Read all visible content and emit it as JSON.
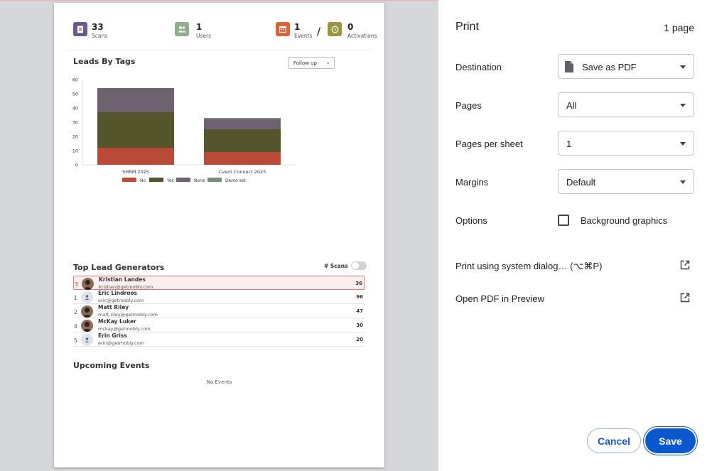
{
  "preview": {
    "stats": {
      "scans": {
        "count": "33",
        "label": "Scans",
        "color": "#6a5a8a",
        "icon": "badge-icon"
      },
      "users": {
        "count": "1",
        "label": "Users",
        "color": "#8fb08a",
        "icon": "users-icon"
      },
      "events": {
        "count": "1",
        "label": "Events",
        "color": "#d9623b",
        "icon": "calendar-icon"
      },
      "activations": {
        "count": "0",
        "label": "Activations",
        "color": "#9a963f",
        "icon": "clock-icon"
      },
      "separator": "/"
    },
    "leads_by_tags": {
      "title": "Leads By Tags",
      "filter_value": "Follow up"
    },
    "top_lead_generators": {
      "title": "Top Lead Generators",
      "toggle_label": "# Scans",
      "rows": [
        {
          "rank": "3",
          "name": "Kristian Landes",
          "email": "kristian@getmobly.com",
          "scans": "36",
          "avatar": "photo"
        },
        {
          "rank": "1",
          "name": "Eric Lindroos",
          "email": "eric@getmobly.com",
          "scans": "96",
          "avatar": "placeholder"
        },
        {
          "rank": "2",
          "name": "Matt Riley",
          "email": "matt.riley@getmobly.com",
          "scans": "47",
          "avatar": "photo"
        },
        {
          "rank": "4",
          "name": "McKay Luker",
          "email": "mckay@getmobly.com",
          "scans": "30",
          "avatar": "photo"
        },
        {
          "rank": "5",
          "name": "Erin Griss",
          "email": "erin@getmobly.com",
          "scans": "20",
          "avatar": "placeholder"
        }
      ]
    },
    "upcoming_events": {
      "title": "Upcoming Events",
      "empty_text": "No Events"
    }
  },
  "chart_data": {
    "type": "bar",
    "stacked": true,
    "categories": [
      "SHRM 2025",
      "Cvent Connect 2025"
    ],
    "series": [
      {
        "name": "No",
        "values": [
          12,
          9
        ],
        "color": "#b94a38"
      },
      {
        "name": "Yes",
        "values": [
          25,
          16
        ],
        "color": "#55552c"
      },
      {
        "name": "None",
        "values": [
          17,
          7
        ],
        "color": "#6e6270"
      },
      {
        "name": "Demo set",
        "values": [
          0,
          1
        ],
        "color": "#7a8f7a"
      }
    ],
    "ylim": [
      0,
      60
    ],
    "yticks": [
      "0",
      "10",
      "20",
      "30",
      "40",
      "50",
      "60"
    ],
    "legend_position": "bottom"
  },
  "print_panel": {
    "title": "Print",
    "page_count": "1 page",
    "destination": {
      "label": "Destination",
      "value": "Save as PDF"
    },
    "pages": {
      "label": "Pages",
      "value": "All"
    },
    "pages_per_sheet": {
      "label": "Pages per sheet",
      "value": "1"
    },
    "margins": {
      "label": "Margins",
      "value": "Default"
    },
    "options": {
      "label": "Options",
      "background_graphics": "Background graphics"
    },
    "system_dialog": "Print using system dialog… (⌥⌘P)",
    "open_preview": "Open PDF in Preview",
    "cancel": "Cancel",
    "save": "Save",
    "accent_color": "#0b57d0"
  }
}
